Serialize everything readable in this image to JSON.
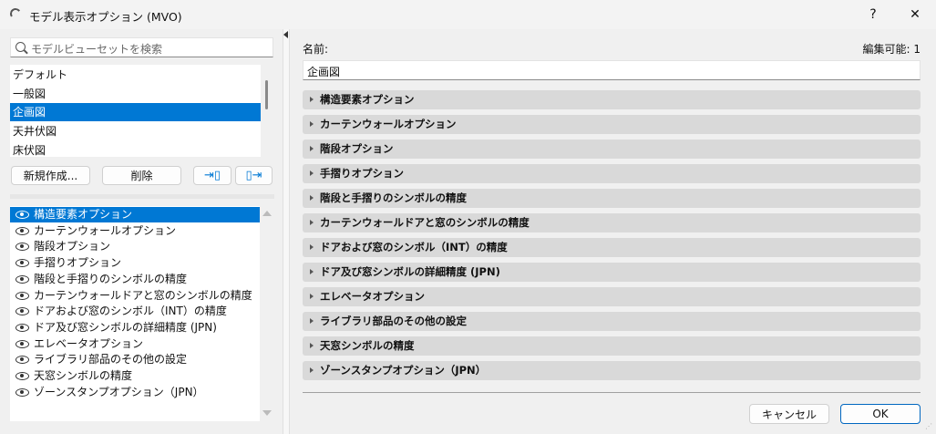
{
  "window": {
    "title": "モデル表示オプション (MVO)",
    "help": "?",
    "close": "✕"
  },
  "search": {
    "placeholder": "モデルビューセットを検索"
  },
  "presets": [
    "デフォルト",
    "一般図",
    "企画図",
    "天井伏図",
    "床伏図"
  ],
  "selected_preset": 2,
  "buttons": {
    "new": "新規作成...",
    "delete": "削除",
    "cancel": "キャンセル",
    "ok": "OK"
  },
  "options": [
    "構造要素オプション",
    "カーテンウォールオプション",
    "階段オプション",
    "手摺りオプション",
    "階段と手摺りのシンボルの精度",
    "カーテンウォールドアと窓のシンボルの精度",
    "ドアおよび窓のシンボル（INT）の精度",
    "ドア及び窓シンボルの詳細精度 (JPN)",
    "エレベータオプション",
    "ライブラリ部品のその他の設定",
    "天窓シンボルの精度",
    "ゾーンスタンプオプション（JPN）"
  ],
  "name_label": "名前:",
  "name_value": "企画図",
  "editable": "編集可能: 1",
  "accent": "#0078d4"
}
